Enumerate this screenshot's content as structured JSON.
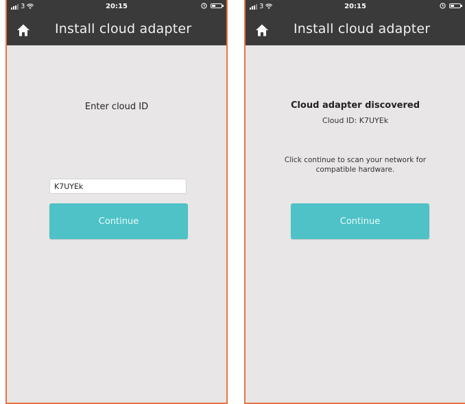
{
  "status_bar": {
    "carrier": "3",
    "time": "20:15"
  },
  "nav": {
    "title": "Install cloud adapter",
    "home_icon": "home-icon"
  },
  "left_screen": {
    "heading": "Enter cloud ID",
    "cloud_id_input_value": "K7UYEk",
    "continue_label": "Continue"
  },
  "right_screen": {
    "heading": "Cloud adapter discovered",
    "cloud_id_line": "Cloud ID: K7UYEk",
    "instructions": "Click continue to scan your network for compatible hardware.",
    "continue_label": "Continue"
  },
  "colors": {
    "nav_background": "#3a3a3a",
    "accent_button": "#4ec2c6",
    "frame_border": "#e8733f",
    "screen_background": "#e8e6e6"
  }
}
